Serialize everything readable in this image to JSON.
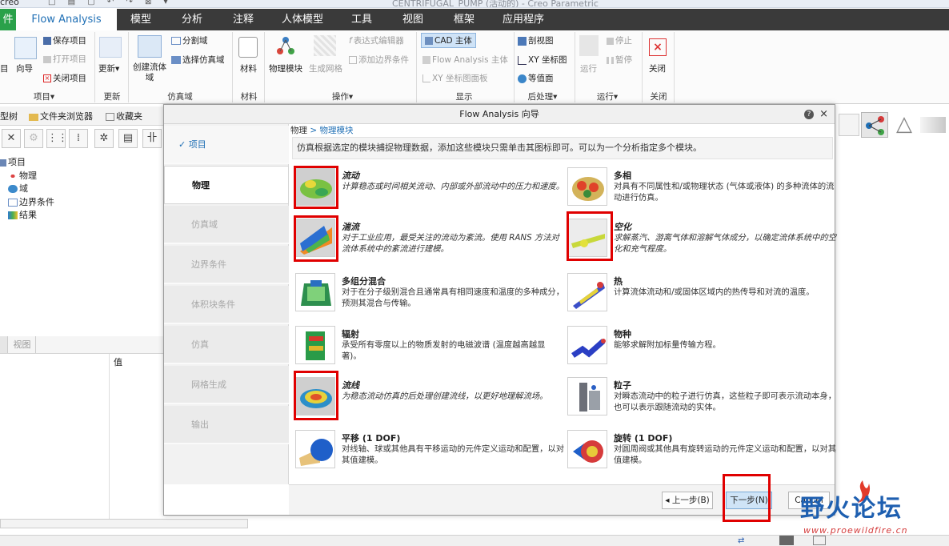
{
  "window": {
    "logo": "creo",
    "title": "CENTRIFUGAL_PUMP (活动的) - Creo Parametric",
    "quick_access": "□ ▤ ▢ ↶ ↷ ⊠ ▾"
  },
  "tabs": [
    "件",
    "Flow Analysis",
    "模型",
    "分析",
    "注释",
    "人体模型",
    "工具",
    "视图",
    "框架",
    "应用程序"
  ],
  "ribbon": {
    "project": {
      "open": "目",
      "wizard": "向导",
      "save": "保存项目",
      "open_project": "打开项目",
      "close": "关闭项目",
      "group": "项目▾"
    },
    "update": {
      "label": "更新▾",
      "group": "更新"
    },
    "domain": {
      "create": "创建流体域",
      "split": "分割域",
      "select": "选择仿真域",
      "group": "仿真域"
    },
    "material": {
      "label": "材料",
      "group": "材料"
    },
    "ops": {
      "physics": "物理模块",
      "mesh": "生成网格",
      "expr": "表达式编辑器",
      "bc": "添加边界条件",
      "group": "操作▾"
    },
    "display": {
      "cad": "CAD 主体",
      "fa": "Flow Analysis 主体",
      "xy_panel": "XY 坐标图面板",
      "group": "显示"
    },
    "post": {
      "section": "剖视图",
      "xy": "XY 坐标图",
      "iso": "等值面",
      "group": "后处理▾"
    },
    "run": {
      "run": "运行",
      "stop": "停止",
      "pause": "暂停",
      "group": "运行▾"
    },
    "close": {
      "label": "关闭",
      "group": "关闭"
    }
  },
  "left": {
    "tabs": [
      "型树",
      "文件夹浏览器",
      "收藏夹"
    ],
    "tree": [
      "项目",
      "物理",
      "域",
      "边界条件",
      "结果"
    ],
    "bottom_tab": "视图",
    "col_value": "值"
  },
  "dialog": {
    "title": "Flow Analysis 向导",
    "steps": [
      "项目",
      "物理",
      "仿真域",
      "边界条件",
      "体积块条件",
      "仿真",
      "网格生成",
      "输出"
    ],
    "breadcrumb_root": "物理",
    "breadcrumb_sep": " > ",
    "breadcrumb_current": "物理模块",
    "description": "仿真根据选定的模块捕捉物理数据，添加这些模块只需单击其图标即可。可以为一个分析指定多个模块。",
    "modules": [
      {
        "title": "流动",
        "desc": "计算稳态或时间相关流动、内部或外部流动中的压力和速度。",
        "selected": true
      },
      {
        "title": "多相",
        "desc": "对具有不同属性和/或物理状态 (气体或液体) 的多种流体的流动进行仿真。",
        "selected": false
      },
      {
        "title": "湍流",
        "desc": "对于工业应用，最受关注的流动为紊流。使用 RANS 方法对流体系统中的紊流进行建模。",
        "selected": true
      },
      {
        "title": "空化",
        "desc": "求解蒸汽、游离气体和溶解气体成分，以确定流体系统中的空化和充气程度。",
        "selected": true
      },
      {
        "title": "多组分混合",
        "desc": "对于在分子级别混合且通常具有相同速度和温度的多种成分，预测其混合与传输。",
        "selected": false
      },
      {
        "title": "热",
        "desc": "计算流体流动和/或固体区域内的热传导和对流的温度。",
        "selected": false
      },
      {
        "title": "辐射",
        "desc": "承受所有零度以上的物质发射的电磁波谱 (温度越高越显著)。",
        "selected": false
      },
      {
        "title": "物种",
        "desc": "能够求解附加标量传输方程。",
        "selected": false
      },
      {
        "title": "流线",
        "desc": "为稳态流动仿真的后处理创建流线，以更好地理解流场。",
        "selected": true
      },
      {
        "title": "粒子",
        "desc": "对瞬态流动中的粒子进行仿真，这些粒子即可表示流动本身，也可以表示跟随流动的实体。",
        "selected": false
      },
      {
        "title": "平移 (1 DOF)",
        "desc": "对线轴、球或其他具有平移运动的元件定义运动和配置，以对其值建模。",
        "selected": false
      },
      {
        "title": "旋转 (1 DOF)",
        "desc": "对圆周阀或其他具有旋转运动的元件定义运动和配置，以对其值建模。",
        "selected": false
      }
    ],
    "buttons": {
      "prev": "◂ 上一步(B)",
      "next": "下一步(N)",
      "cancel": "Cancel"
    }
  },
  "watermark": {
    "text": "野火论坛",
    "url": "www.proewildfire.cn"
  },
  "colors": {
    "accent": "#1f6fb5",
    "tab_bar": "#3a3a3a",
    "highlight": "#e00000",
    "green_tab": "#2aa14a"
  }
}
